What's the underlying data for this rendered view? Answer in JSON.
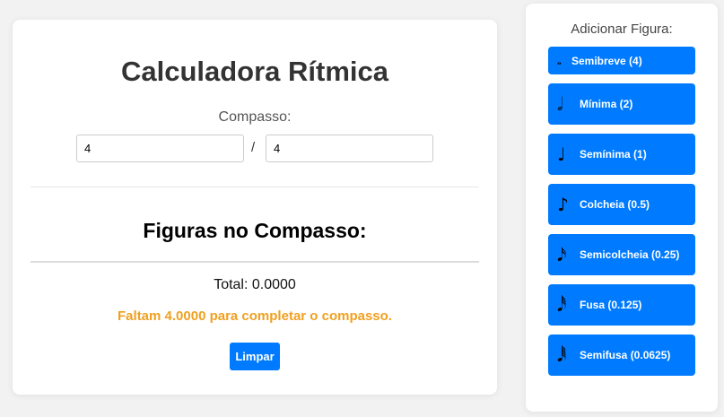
{
  "main": {
    "title": "Calculadora Rítmica",
    "compasso_label": "Compasso:",
    "numerator_value": "4",
    "separator": "/",
    "denominator_value": "4",
    "figures_heading": "Figuras no Compasso:",
    "total_text": "Total: 0.0000",
    "faltam_text": "Faltam 4.0000 para completar o compasso.",
    "clear_label": "Limpar"
  },
  "sidebar": {
    "title": "Adicionar Figura:",
    "figures": [
      {
        "icon": "whole-note-icon",
        "glyph": "𝅝",
        "label": "Semibreve (4)"
      },
      {
        "icon": "half-note-icon",
        "glyph": "𝅗𝅥",
        "label": "Mínima (2)"
      },
      {
        "icon": "quarter-note-icon",
        "glyph": "♩",
        "label": "Semínima (1)"
      },
      {
        "icon": "eighth-note-icon",
        "glyph": "♪",
        "label": "Colcheia (0.5)"
      },
      {
        "icon": "sixteenth-note-icon",
        "glyph": "𝅘𝅥𝅯",
        "label": "Semicolcheia (0.25)"
      },
      {
        "icon": "thirty-second-note-icon",
        "glyph": "𝅘𝅥𝅰",
        "label": "Fusa (0.125)"
      },
      {
        "icon": "sixty-fourth-note-icon",
        "glyph": "𝅘𝅥𝅱",
        "label": "Semifusa (0.0625)"
      }
    ]
  },
  "colors": {
    "accent": "#007bff",
    "warning": "#f0a020",
    "background": "#f2f2f2"
  }
}
